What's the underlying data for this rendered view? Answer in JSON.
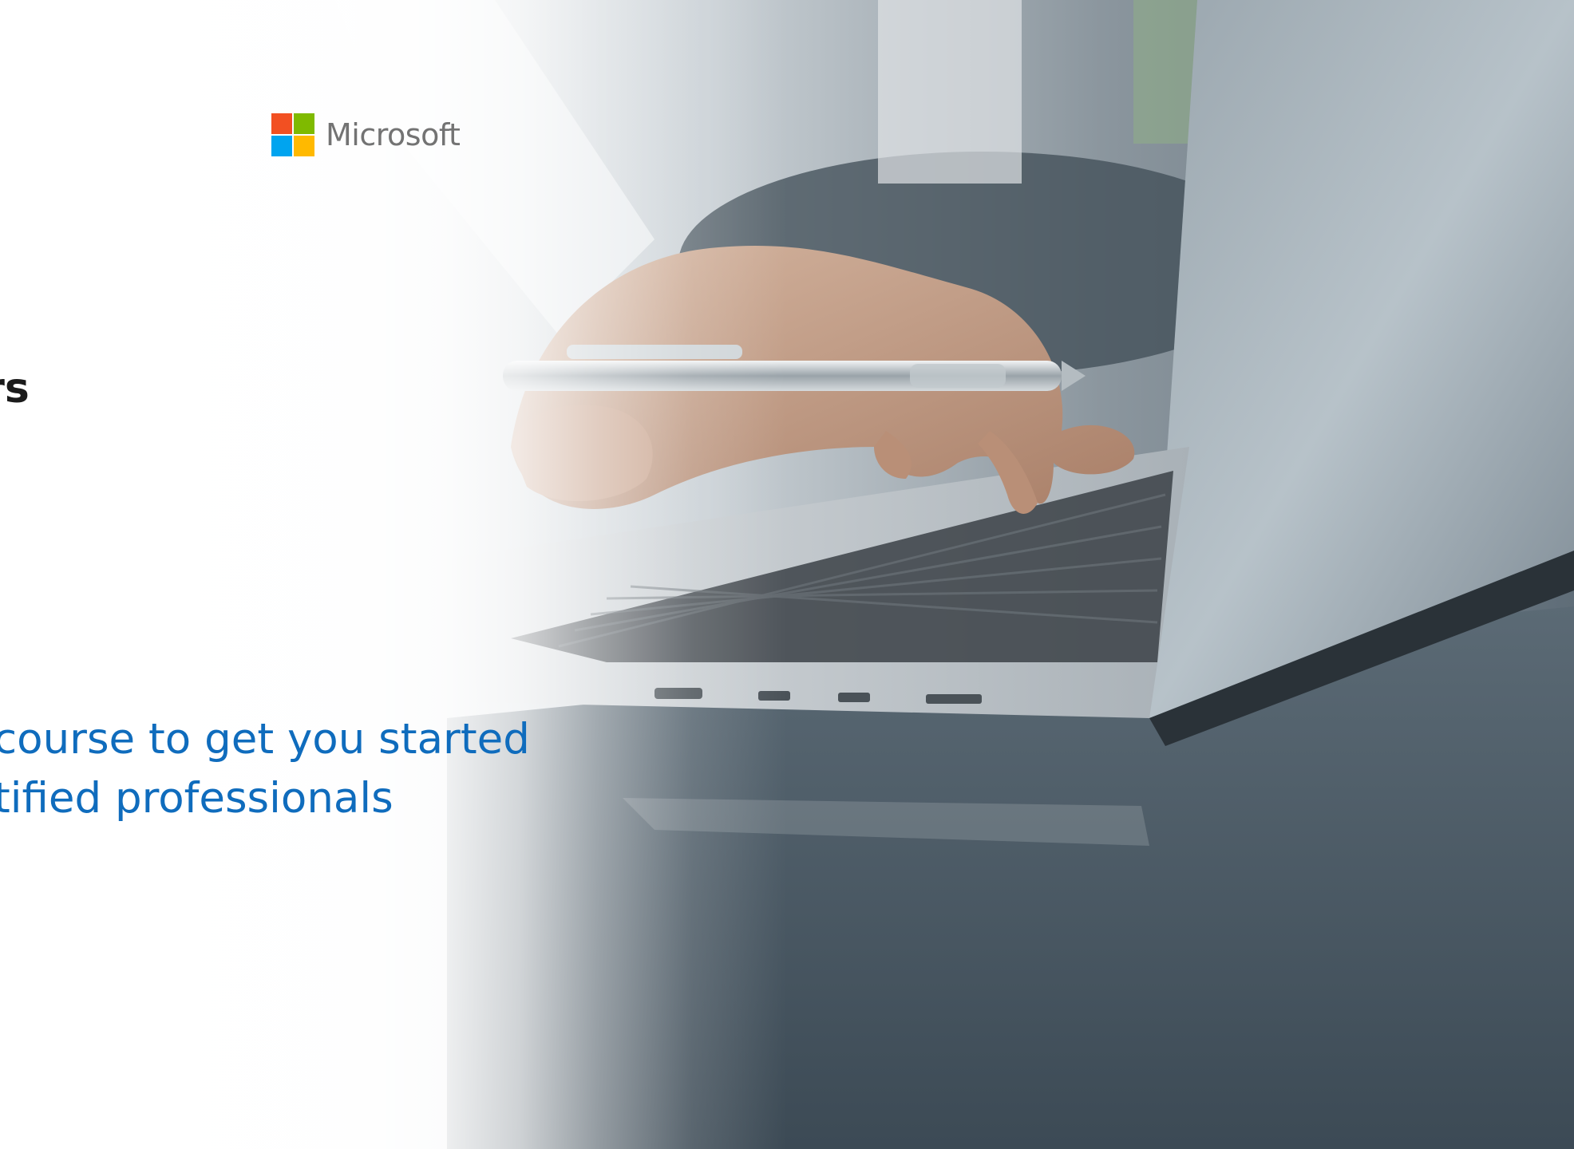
{
  "brand": {
    "name": "Microsoft",
    "logo_colors": {
      "red": "#f25022",
      "green": "#7fba00",
      "blue": "#00a4ef",
      "yellow": "#ffb900"
    }
  },
  "heading": {
    "text": "opers"
  },
  "subtitle": {
    "line1": "course to get you started",
    "line2": "tified professionals"
  },
  "colors": {
    "heading": "#1b1b1b",
    "subtitle": "#0f6cbd",
    "logo_text": "#737373"
  }
}
